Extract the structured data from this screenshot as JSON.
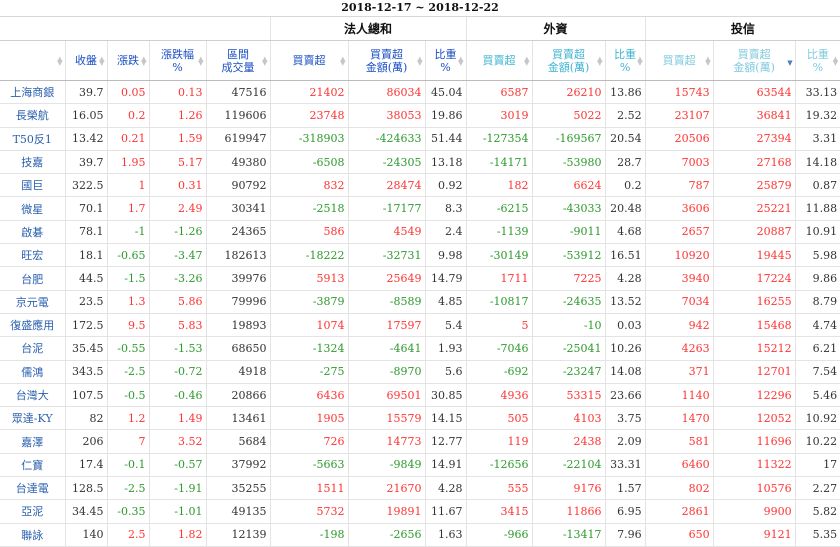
{
  "date_range": "2018-12-17 ~ 2018-12-22",
  "groups": {
    "legal": "法人總和",
    "foreign": "外資",
    "trust": "投信"
  },
  "columns": [
    {
      "label": "",
      "sub": ""
    },
    {
      "label": "收盤",
      "sub": ""
    },
    {
      "label": "漲跌",
      "sub": ""
    },
    {
      "label": "漲跌幅",
      "sub": "%"
    },
    {
      "label": "區間",
      "sub": "成交量"
    },
    {
      "label": "買賣超",
      "sub": ""
    },
    {
      "label": "買賣超",
      "sub": "金額(萬)"
    },
    {
      "label": "比重",
      "sub": "%"
    },
    {
      "label": "買賣超",
      "sub": ""
    },
    {
      "label": "買賣超",
      "sub": "金額(萬)"
    },
    {
      "label": "比重",
      "sub": "%"
    },
    {
      "label": "買賣超",
      "sub": ""
    },
    {
      "label": "買賣超",
      "sub": "金額(萬)"
    },
    {
      "label": "比重",
      "sub": "%"
    }
  ],
  "rows": [
    [
      "上海商銀",
      "39.7",
      "0.05",
      "0.13",
      "47516",
      "21402",
      "86034",
      "45.04",
      "6587",
      "26210",
      "13.86",
      "15743",
      "63544",
      "33.13"
    ],
    [
      "長榮航",
      "16.05",
      "0.2",
      "1.26",
      "119606",
      "23748",
      "38053",
      "19.86",
      "3019",
      "5022",
      "2.52",
      "23107",
      "36841",
      "19.32"
    ],
    [
      "T50反1",
      "13.42",
      "0.21",
      "1.59",
      "619947",
      "-318903",
      "-424633",
      "51.44",
      "-127354",
      "-169567",
      "20.54",
      "20506",
      "27394",
      "3.31"
    ],
    [
      "技嘉",
      "39.7",
      "1.95",
      "5.17",
      "49380",
      "-6508",
      "-24305",
      "13.18",
      "-14171",
      "-53980",
      "28.7",
      "7003",
      "27168",
      "14.18"
    ],
    [
      "國巨",
      "322.5",
      "1",
      "0.31",
      "90792",
      "832",
      "28474",
      "0.92",
      "182",
      "6624",
      "0.2",
      "787",
      "25879",
      "0.87"
    ],
    [
      "微星",
      "70.1",
      "1.7",
      "2.49",
      "30341",
      "-2518",
      "-17177",
      "8.3",
      "-6215",
      "-43033",
      "20.48",
      "3606",
      "25221",
      "11.88"
    ],
    [
      "啟碁",
      "78.1",
      "-1",
      "-1.26",
      "24365",
      "586",
      "4549",
      "2.4",
      "-1139",
      "-9011",
      "4.68",
      "2657",
      "20887",
      "10.91"
    ],
    [
      "旺宏",
      "18.1",
      "-0.65",
      "-3.47",
      "182613",
      "-18222",
      "-32731",
      "9.98",
      "-30149",
      "-53912",
      "16.51",
      "10920",
      "19445",
      "5.98"
    ],
    [
      "台肥",
      "44.5",
      "-1.5",
      "-3.26",
      "39976",
      "5913",
      "25649",
      "14.79",
      "1711",
      "7225",
      "4.28",
      "3940",
      "17224",
      "9.86"
    ],
    [
      "京元電",
      "23.5",
      "1.3",
      "5.86",
      "79996",
      "-3879",
      "-8589",
      "4.85",
      "-10817",
      "-24635",
      "13.52",
      "7034",
      "16255",
      "8.79"
    ],
    [
      "復盛應用",
      "172.5",
      "9.5",
      "5.83",
      "19893",
      "1074",
      "17597",
      "5.4",
      "5",
      "-10",
      "0.03",
      "942",
      "15468",
      "4.74"
    ],
    [
      "台泥",
      "35.45",
      "-0.55",
      "-1.53",
      "68650",
      "-1324",
      "-4641",
      "1.93",
      "-7046",
      "-25041",
      "10.26",
      "4263",
      "15212",
      "6.21"
    ],
    [
      "儒鴻",
      "343.5",
      "-2.5",
      "-0.72",
      "4918",
      "-275",
      "-8970",
      "5.6",
      "-692",
      "-23247",
      "14.08",
      "371",
      "12701",
      "7.54"
    ],
    [
      "台灣大",
      "107.5",
      "-0.5",
      "-0.46",
      "20866",
      "6436",
      "69501",
      "30.85",
      "4936",
      "53315",
      "23.66",
      "1140",
      "12296",
      "5.46"
    ],
    [
      "眾達-KY",
      "82",
      "1.2",
      "1.49",
      "13461",
      "1905",
      "15579",
      "14.15",
      "505",
      "4103",
      "3.75",
      "1470",
      "12052",
      "10.92"
    ],
    [
      "嘉澤",
      "206",
      "7",
      "3.52",
      "5684",
      "726",
      "14773",
      "12.77",
      "119",
      "2438",
      "2.09",
      "581",
      "11696",
      "10.22"
    ],
    [
      "仁寶",
      "17.4",
      "-0.1",
      "-0.57",
      "37992",
      "-5663",
      "-9849",
      "14.91",
      "-12656",
      "-22104",
      "33.31",
      "6460",
      "11322",
      "17"
    ],
    [
      "台達電",
      "128.5",
      "-2.5",
      "-1.91",
      "35255",
      "1511",
      "21670",
      "4.28",
      "555",
      "9176",
      "1.57",
      "802",
      "10576",
      "2.27"
    ],
    [
      "亞泥",
      "34.45",
      "-0.35",
      "-1.01",
      "49135",
      "5732",
      "19891",
      "11.67",
      "3415",
      "11866",
      "6.95",
      "2861",
      "9900",
      "5.82"
    ],
    [
      "聯詠",
      "140",
      "2.5",
      "1.82",
      "12139",
      "-198",
      "-2656",
      "1.63",
      "-966",
      "-13417",
      "7.96",
      "650",
      "9121",
      "5.35"
    ]
  ]
}
